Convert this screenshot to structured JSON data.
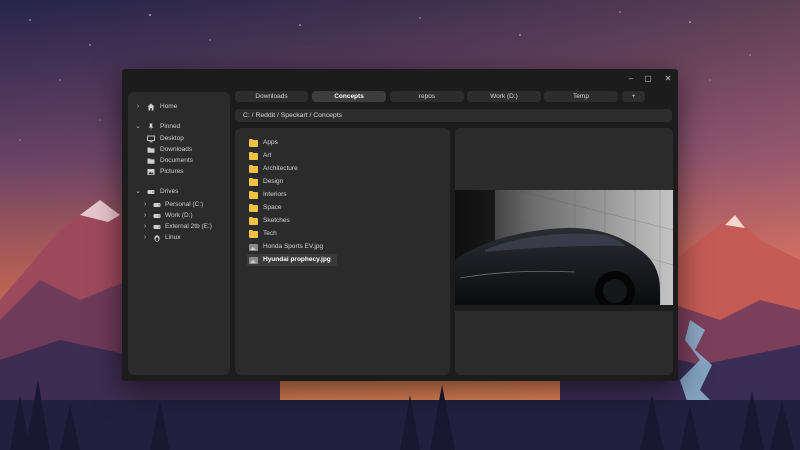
{
  "window": {
    "controls": {
      "minimize": "–",
      "maximize": "▢",
      "close": "✕"
    }
  },
  "sidebar": {
    "home": "Home",
    "pinned": {
      "label": "Pinned",
      "items": [
        "Desktop",
        "Downloads",
        "Documents",
        "Pictures"
      ]
    },
    "drives": {
      "label": "Drives",
      "items": [
        "Personal (C:)",
        "Work (D:)",
        "External 2tb (E:)",
        "Linux"
      ]
    }
  },
  "tabs": [
    {
      "label": "Downloads",
      "active": false
    },
    {
      "label": "Concepts",
      "active": true
    },
    {
      "label": "repos",
      "active": false
    },
    {
      "label": "Work (D:)",
      "active": false
    },
    {
      "label": "Temp",
      "active": false
    }
  ],
  "new_tab": "+",
  "path": "C: / Reddit / Speckart / Concepts",
  "files": [
    {
      "name": "Apps",
      "type": "folder"
    },
    {
      "name": "Art",
      "type": "folder"
    },
    {
      "name": "Architecture",
      "type": "folder"
    },
    {
      "name": "Design",
      "type": "folder"
    },
    {
      "name": "Interiors",
      "type": "folder"
    },
    {
      "name": "Space",
      "type": "folder"
    },
    {
      "name": "Sketches",
      "type": "folder"
    },
    {
      "name": "Tech",
      "type": "folder"
    },
    {
      "name": "Honda Sports EV.jpg",
      "type": "image"
    },
    {
      "name": "Hyundai prophecy.jpg",
      "type": "image",
      "selected": true
    }
  ],
  "colors": {
    "window_bg": "#1c1c1c",
    "panel_bg": "#2b2b2b",
    "tab_bg": "#2d2d2d",
    "tab_active_bg": "#3d3d3d",
    "folder": "#f3c244"
  },
  "icons": {
    "home": "home-icon",
    "pinned": "pin-icon",
    "desktop": "monitor-icon",
    "downloads": "folder-icon",
    "drives": "drive-icon",
    "linux": "penguin-icon"
  }
}
